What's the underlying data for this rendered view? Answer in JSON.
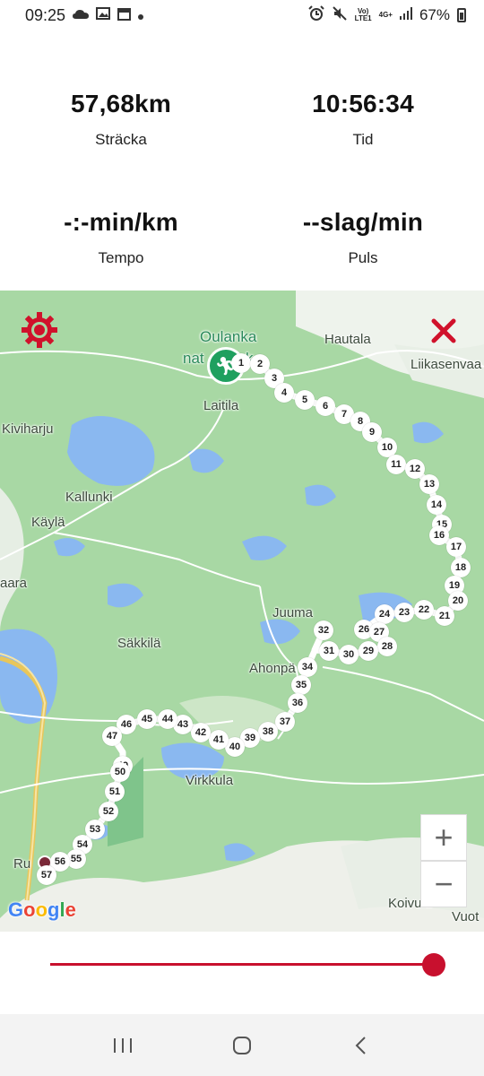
{
  "status_bar": {
    "time": "09:25",
    "network_top": "Vo)",
    "network_bottom": "LTE1",
    "signal_type": "4G+",
    "battery": "67%",
    "left_icons": [
      "cloud-icon",
      "image-icon",
      "calendar-icon",
      "dot-icon"
    ],
    "right_icons": [
      "alarm-icon",
      "mute-icon",
      "signal-icon",
      "battery-icon"
    ]
  },
  "stats": {
    "distance": {
      "value": "57,68km",
      "label": "Sträcka"
    },
    "time": {
      "value": "10:56:34",
      "label": "Tid"
    },
    "pace": {
      "value": "-:-min/km",
      "label": "Tempo"
    },
    "pulse": {
      "value": "--slag/min",
      "label": "Puls"
    }
  },
  "map": {
    "places": {
      "oulanka_1": "Oulanka",
      "oulanka_2": "nat",
      "oulanka_3": "k",
      "hautala": "Hautala",
      "liikasenvaara": "Liikasenvaa",
      "laitila": "Laitila",
      "kiviharju": "Kiviharju",
      "kallunki": "Kallunki",
      "kayla": "Käylä",
      "aara": "aara",
      "juuma": "Juuma",
      "sakkila": "Säkkilä",
      "ahonpaa": "Ahonpä",
      "virkkula": "Virkkula",
      "ruka": "Ru",
      "koivula": "Koivula",
      "vuot": "Vuot"
    },
    "google_logo": "Google",
    "zoom_in": "+",
    "zoom_out": "−",
    "colors": {
      "route_marker": "#ffffff",
      "start_pin": "#1fa05f",
      "end_pin": "#7a2838",
      "water": "#8ab8f0",
      "forest": "#a8d8a4"
    },
    "markers": [
      "1",
      "2",
      "3",
      "4",
      "5",
      "6",
      "7",
      "8",
      "9",
      "10",
      "11",
      "12",
      "13",
      "14",
      "15",
      "16",
      "17",
      "18",
      "19",
      "20",
      "21",
      "22",
      "23",
      "24",
      "26",
      "27",
      "28",
      "29",
      "30",
      "31",
      "32",
      "34",
      "35",
      "36",
      "37",
      "38",
      "39",
      "40",
      "41",
      "42",
      "43",
      "44",
      "45",
      "46",
      "47",
      "49",
      "50",
      "51",
      "52",
      "53",
      "54",
      "55",
      "56",
      "57"
    ]
  },
  "slider": {
    "value_fraction": 1.0,
    "color": "#c8102e"
  },
  "nav": {
    "icons": [
      "recent-apps-icon",
      "home-icon",
      "back-icon"
    ]
  }
}
